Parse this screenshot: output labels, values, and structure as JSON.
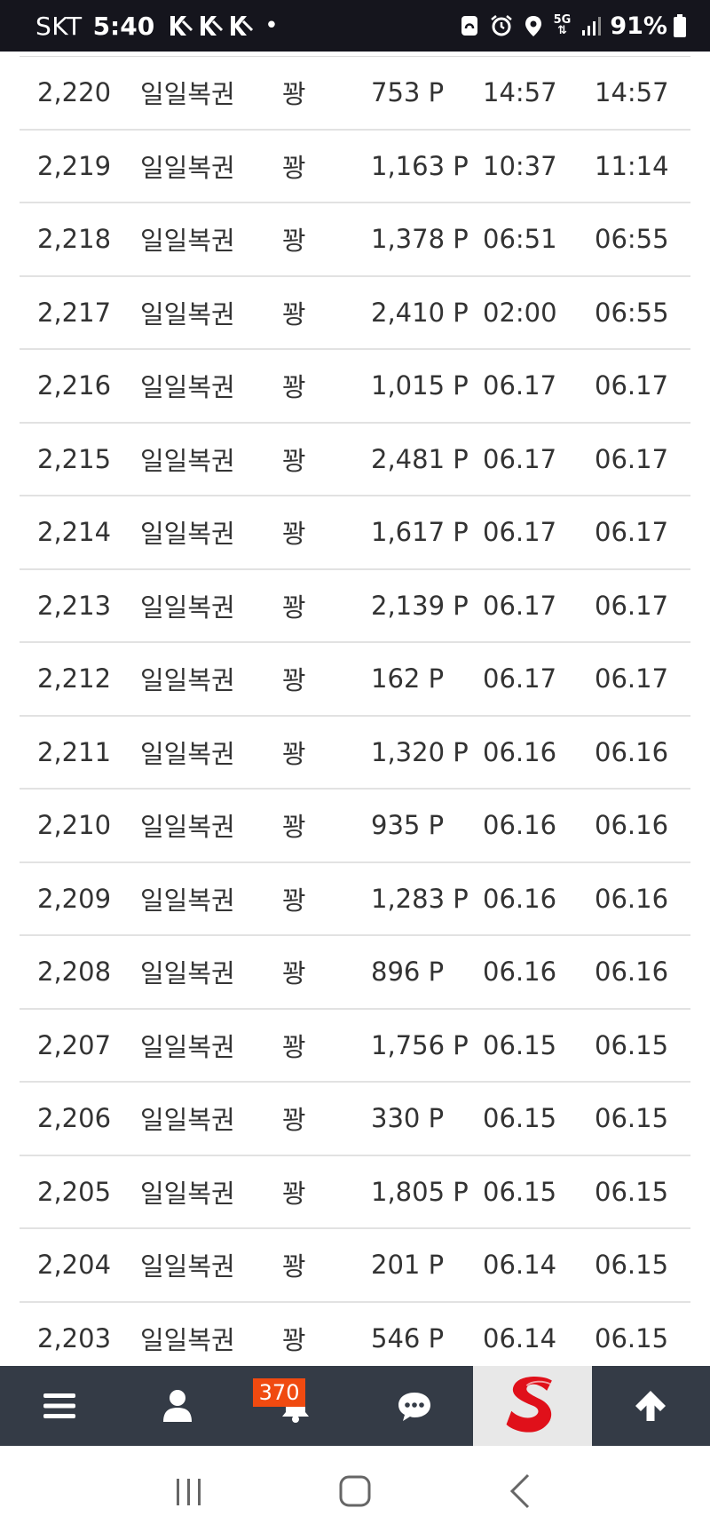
{
  "status_bar": {
    "carrier": "SKT",
    "time": "5:40",
    "dot": "•",
    "battery_percent": "91%",
    "network": "5G",
    "icons": [
      "k-notification-icon",
      "k-notification-icon",
      "k-notification-icon",
      "nfc-icon",
      "alarm-icon",
      "location-icon",
      "5g-icon",
      "signal-icon",
      "battery-icon"
    ]
  },
  "rows": [
    {
      "no": "2,220",
      "name": "일일복권",
      "type": "꽝",
      "points": "753 P",
      "t1": "14:57",
      "t2": "14:57"
    },
    {
      "no": "2,219",
      "name": "일일복권",
      "type": "꽝",
      "points": "1,163 P",
      "t1": "10:37",
      "t2": "11:14"
    },
    {
      "no": "2,218",
      "name": "일일복권",
      "type": "꽝",
      "points": "1,378 P",
      "t1": "06:51",
      "t2": "06:55"
    },
    {
      "no": "2,217",
      "name": "일일복권",
      "type": "꽝",
      "points": "2,410 P",
      "t1": "02:00",
      "t2": "06:55"
    },
    {
      "no": "2,216",
      "name": "일일복권",
      "type": "꽝",
      "points": "1,015 P",
      "t1": "06.17",
      "t2": "06.17"
    },
    {
      "no": "2,215",
      "name": "일일복권",
      "type": "꽝",
      "points": "2,481 P",
      "t1": "06.17",
      "t2": "06.17"
    },
    {
      "no": "2,214",
      "name": "일일복권",
      "type": "꽝",
      "points": "1,617 P",
      "t1": "06.17",
      "t2": "06.17"
    },
    {
      "no": "2,213",
      "name": "일일복권",
      "type": "꽝",
      "points": "2,139 P",
      "t1": "06.17",
      "t2": "06.17"
    },
    {
      "no": "2,212",
      "name": "일일복권",
      "type": "꽝",
      "points": "162 P",
      "t1": "06.17",
      "t2": "06.17"
    },
    {
      "no": "2,211",
      "name": "일일복권",
      "type": "꽝",
      "points": "1,320 P",
      "t1": "06.16",
      "t2": "06.16"
    },
    {
      "no": "2,210",
      "name": "일일복권",
      "type": "꽝",
      "points": "935 P",
      "t1": "06.16",
      "t2": "06.16"
    },
    {
      "no": "2,209",
      "name": "일일복권",
      "type": "꽝",
      "points": "1,283 P",
      "t1": "06.16",
      "t2": "06.16"
    },
    {
      "no": "2,208",
      "name": "일일복권",
      "type": "꽝",
      "points": "896 P",
      "t1": "06.16",
      "t2": "06.16"
    },
    {
      "no": "2,207",
      "name": "일일복권",
      "type": "꽝",
      "points": "1,756 P",
      "t1": "06.15",
      "t2": "06.15"
    },
    {
      "no": "2,206",
      "name": "일일복권",
      "type": "꽝",
      "points": "330 P",
      "t1": "06.15",
      "t2": "06.15"
    },
    {
      "no": "2,205",
      "name": "일일복권",
      "type": "꽝",
      "points": "1,805 P",
      "t1": "06.15",
      "t2": "06.15"
    },
    {
      "no": "2,204",
      "name": "일일복권",
      "type": "꽝",
      "points": "201 P",
      "t1": "06.14",
      "t2": "06.15"
    },
    {
      "no": "2,203",
      "name": "일일복권",
      "type": "꽝",
      "points": "546 P",
      "t1": "06.14",
      "t2": "06.15"
    }
  ],
  "toolbar": {
    "items": [
      "menu-icon",
      "user-icon",
      "bell-icon",
      "chat-icon",
      "site-logo",
      "arrow-up-icon"
    ],
    "notification_count": "370",
    "colors": {
      "background": "#343b46",
      "badge": "#f04a10",
      "logo_bg": "#e8e8e8",
      "logo_red": "#e0101a"
    }
  },
  "navbar": {
    "items": [
      "recent-apps-icon",
      "home-icon",
      "back-icon"
    ]
  }
}
